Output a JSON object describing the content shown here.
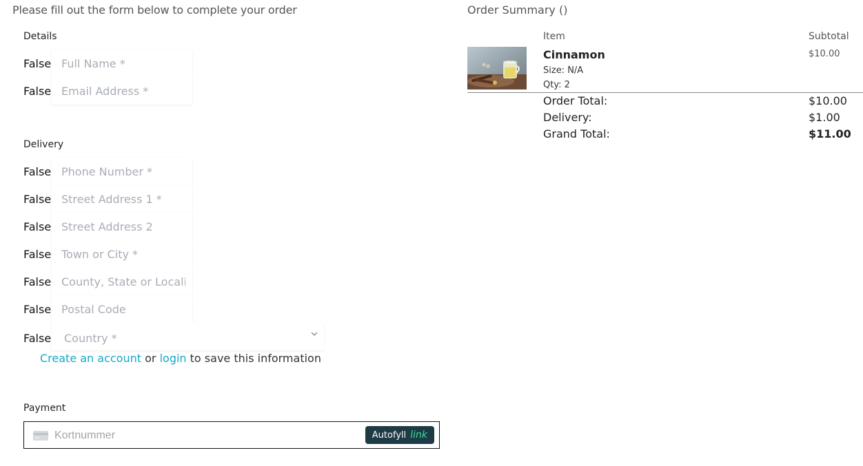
{
  "form": {
    "intro": "Please fill out the form below to complete your order",
    "details_label": "Details",
    "delivery_label": "Delivery",
    "payment_label": "Payment",
    "flag_text": "False",
    "full_name_placeholder": "Full Name *",
    "email_placeholder": "Email Address *",
    "phone_placeholder": "Phone Number *",
    "street1_placeholder": "Street Address 1 *",
    "street2_placeholder": "Street Address 2",
    "town_placeholder": "Town or City *",
    "county_placeholder": "County, State or Locality",
    "postal_placeholder": "Postal Code",
    "country_selected": "Country *",
    "account_link": "Create an account",
    "or_text": " or ",
    "login_link": "login",
    "save_text": " to save this information",
    "card_placeholder": "Kortnummer",
    "autofill_label": "Autofyll",
    "autofill_brand": "link"
  },
  "summary": {
    "title": "Order Summary ()",
    "col_item": "Item",
    "col_subtotal": "Subtotal",
    "items": [
      {
        "name": "Cinnamon",
        "size": "Size: N/A",
        "qty": "Qty: 2",
        "price": "$10.00"
      }
    ],
    "order_total_label": "Order Total:",
    "order_total_value": "$10.00",
    "delivery_label": "Delivery:",
    "delivery_value": "$1.00",
    "grand_total_label": "Grand Total:",
    "grand_total_value": "$11.00"
  },
  "colors": {
    "link": "#17a8c4",
    "autofill_bg": "#1e3a44",
    "autofill_brand": "#33dd9a"
  },
  "icons": {
    "card": "credit-card-icon",
    "select_chevron": "chevron-down-icon"
  }
}
